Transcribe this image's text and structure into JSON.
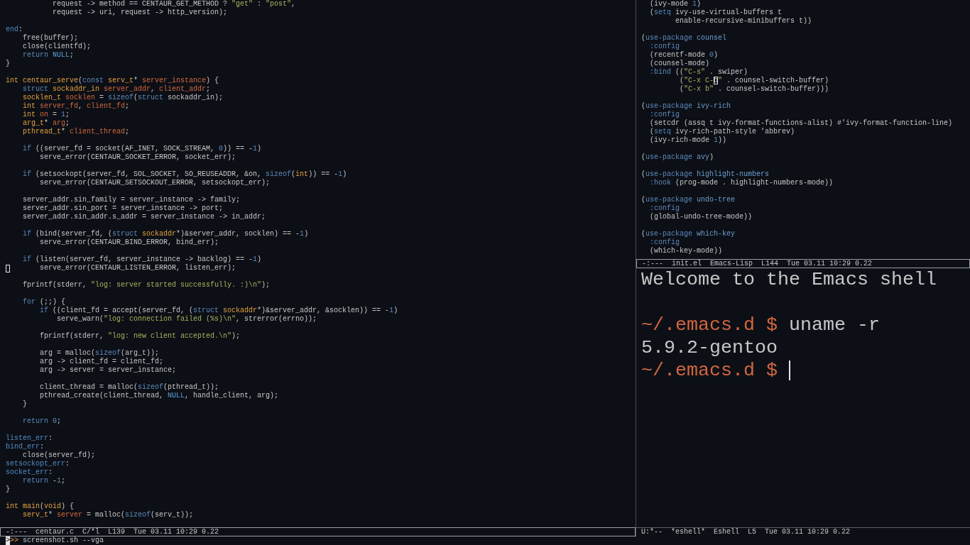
{
  "editor_window": {
    "blocks": [
      [
        [
          {
            "kind": "plain",
            "text": "           request -> method == CENTAUR_GET_METHOD ? "
          },
          {
            "kind": "string",
            "text": "\"get\""
          },
          {
            "kind": "plain",
            "text": " : "
          },
          {
            "kind": "string",
            "text": "\"post\""
          },
          {
            "kind": "plain",
            "text": ","
          }
        ],
        [
          {
            "kind": "plain",
            "text": "           request -> uri, request -> http_version);"
          }
        ]
      ],
      [
        [
          {
            "kind": "label",
            "text": "end"
          },
          {
            "kind": "plain",
            "text": ":"
          }
        ],
        [
          {
            "kind": "plain",
            "text": "    free(buffer);"
          }
        ],
        [
          {
            "kind": "plain",
            "text": "    close(clientfd);"
          }
        ],
        [
          {
            "kind": "keyword",
            "text": "    return"
          },
          {
            "kind": "constant",
            "text": " NULL"
          },
          {
            "kind": "plain",
            "text": ";"
          }
        ],
        [
          {
            "kind": "plain",
            "text": "}"
          }
        ]
      ],
      [
        [
          {
            "kind": "type",
            "text": "int"
          },
          {
            "kind": "function",
            "text": " centaur_serve"
          },
          {
            "kind": "plain",
            "text": "("
          },
          {
            "kind": "keyword",
            "text": "const"
          },
          {
            "kind": "type",
            "text": " serv_t"
          },
          {
            "kind": "plain",
            "text": "* "
          },
          {
            "kind": "variable",
            "text": "server_instance"
          },
          {
            "kind": "plain",
            "text": ") {"
          }
        ],
        [
          {
            "kind": "keyword",
            "text": "    struct"
          },
          {
            "kind": "type",
            "text": " sockaddr_in"
          },
          {
            "kind": "variable",
            "text": " server_addr"
          },
          {
            "kind": "plain",
            "text": ", "
          },
          {
            "kind": "variable",
            "text": "client_addr"
          },
          {
            "kind": "plain",
            "text": ";"
          }
        ],
        [
          {
            "kind": "type",
            "text": "    socklen_t"
          },
          {
            "kind": "variable",
            "text": " socklen"
          },
          {
            "kind": "plain",
            "text": " = "
          },
          {
            "kind": "keyword",
            "text": "sizeof"
          },
          {
            "kind": "plain",
            "text": "("
          },
          {
            "kind": "keyword",
            "text": "struct"
          },
          {
            "kind": "plain",
            "text": " sockaddr_in);"
          }
        ],
        [
          {
            "kind": "type",
            "text": "    int"
          },
          {
            "kind": "variable",
            "text": " server_fd"
          },
          {
            "kind": "plain",
            "text": ", "
          },
          {
            "kind": "variable",
            "text": "client_fd"
          },
          {
            "kind": "plain",
            "text": ";"
          }
        ],
        [
          {
            "kind": "type",
            "text": "    int"
          },
          {
            "kind": "variable",
            "text": " on"
          },
          {
            "kind": "plain",
            "text": " = "
          },
          {
            "kind": "number",
            "text": "1"
          },
          {
            "kind": "plain",
            "text": ";"
          }
        ],
        [
          {
            "kind": "type",
            "text": "    arg_t"
          },
          {
            "kind": "plain",
            "text": "* "
          },
          {
            "kind": "variable",
            "text": "arg"
          },
          {
            "kind": "plain",
            "text": ";"
          }
        ],
        [
          {
            "kind": "type",
            "text": "    pthread_t"
          },
          {
            "kind": "plain",
            "text": "* "
          },
          {
            "kind": "variable",
            "text": "client_thread"
          },
          {
            "kind": "plain",
            "text": ";"
          }
        ]
      ],
      [
        [
          {
            "kind": "keyword",
            "text": "    if"
          },
          {
            "kind": "plain",
            "text": " ((server_fd = socket(AF_INET, SOCK_STREAM, "
          },
          {
            "kind": "number",
            "text": "0"
          },
          {
            "kind": "plain",
            "text": ")) == -"
          },
          {
            "kind": "number",
            "text": "1"
          },
          {
            "kind": "plain",
            "text": ")"
          }
        ],
        [
          {
            "kind": "plain",
            "text": "        serve_error(CENTAUR_SOCKET_ERROR, socket_err);"
          }
        ]
      ],
      [
        [
          {
            "kind": "keyword",
            "text": "    if"
          },
          {
            "kind": "plain",
            "text": " (setsockopt(server_fd, SOL_SOCKET, SO_REUSEADDR, &on, "
          },
          {
            "kind": "keyword",
            "text": "sizeof"
          },
          {
            "kind": "plain",
            "text": "("
          },
          {
            "kind": "type",
            "text": "int"
          },
          {
            "kind": "plain",
            "text": ")) == -"
          },
          {
            "kind": "number",
            "text": "1"
          },
          {
            "kind": "plain",
            "text": ")"
          }
        ],
        [
          {
            "kind": "plain",
            "text": "        serve_error(CENTAUR_SETSOCKOUT_ERROR, setsockopt_err);"
          }
        ]
      ],
      [
        [
          {
            "kind": "plain",
            "text": "    server_addr.sin_family = server_instance -> family;"
          }
        ],
        [
          {
            "kind": "plain",
            "text": "    server_addr.sin_port = server_instance -> port;"
          }
        ],
        [
          {
            "kind": "plain",
            "text": "    server_addr.sin_addr.s_addr = server_instance -> in_addr;"
          }
        ]
      ],
      [
        [
          {
            "kind": "keyword",
            "text": "    if"
          },
          {
            "kind": "plain",
            "text": " (bind(server_fd, ("
          },
          {
            "kind": "keyword",
            "text": "struct"
          },
          {
            "kind": "type",
            "text": " sockaddr"
          },
          {
            "kind": "plain",
            "text": "*)&server_addr, socklen) == -"
          },
          {
            "kind": "number",
            "text": "1"
          },
          {
            "kind": "plain",
            "text": ")"
          }
        ],
        [
          {
            "kind": "plain",
            "text": "        serve_error(CENTAUR_BIND_ERROR, bind_err);"
          }
        ]
      ],
      [
        [
          {
            "kind": "keyword",
            "text": "    if"
          },
          {
            "kind": "plain",
            "text": " (listen(server_fd, server_instance -> backlog) == -"
          },
          {
            "kind": "number",
            "text": "1"
          },
          {
            "kind": "plain",
            "text": ")"
          }
        ],
        [
          {
            "kind": "box_cursor"
          },
          {
            "kind": "plain",
            "text": "       serve_error(CENTAUR_LISTEN_ERROR, listen_err);"
          }
        ]
      ],
      [
        [
          {
            "kind": "plain",
            "text": "    fprintf(stderr, "
          },
          {
            "kind": "string",
            "text": "\"log: server started successfully. :)\\n\""
          },
          {
            "kind": "plain",
            "text": ");"
          }
        ]
      ],
      [
        [
          {
            "kind": "keyword",
            "text": "    for"
          },
          {
            "kind": "plain",
            "text": " (;;) {"
          }
        ],
        [
          {
            "kind": "keyword",
            "text": "        if"
          },
          {
            "kind": "plain",
            "text": " ((client_fd = accept(server_fd, ("
          },
          {
            "kind": "keyword",
            "text": "struct"
          },
          {
            "kind": "type",
            "text": " sockaddr"
          },
          {
            "kind": "plain",
            "text": "*)&server_addr, &socklen)) == -"
          },
          {
            "kind": "number",
            "text": "1"
          },
          {
            "kind": "plain",
            "text": ")"
          }
        ],
        [
          {
            "kind": "plain",
            "text": "            serve_warn("
          },
          {
            "kind": "string",
            "text": "\"log: connection failed (%s)\\n\""
          },
          {
            "kind": "plain",
            "text": ", strerror(errno));"
          }
        ]
      ],
      [
        [
          {
            "kind": "plain",
            "text": "        fprintf(stderr, "
          },
          {
            "kind": "string",
            "text": "\"log: new client accepted.\\n\""
          },
          {
            "kind": "plain",
            "text": ");"
          }
        ]
      ],
      [
        [
          {
            "kind": "plain",
            "text": "        arg = malloc("
          },
          {
            "kind": "keyword",
            "text": "sizeof"
          },
          {
            "kind": "plain",
            "text": "(arg_t));"
          }
        ],
        [
          {
            "kind": "plain",
            "text": "        arg -> client_fd = client_fd;"
          }
        ],
        [
          {
            "kind": "plain",
            "text": "        arg -> server = server_instance;"
          }
        ]
      ],
      [
        [
          {
            "kind": "plain",
            "text": "        client_thread = malloc("
          },
          {
            "kind": "keyword",
            "text": "sizeof"
          },
          {
            "kind": "plain",
            "text": "(pthread_t));"
          }
        ],
        [
          {
            "kind": "plain",
            "text": "        pthread_create(client_thread, "
          },
          {
            "kind": "constant",
            "text": "NULL"
          },
          {
            "kind": "plain",
            "text": ", handle_client, arg);"
          }
        ],
        [
          {
            "kind": "plain",
            "text": "    }"
          }
        ]
      ],
      [
        [
          {
            "kind": "keyword",
            "text": "    return"
          },
          {
            "kind": "number",
            "text": " 0"
          },
          {
            "kind": "plain",
            "text": ";"
          }
        ]
      ],
      [
        [
          {
            "kind": "label",
            "text": "listen_err"
          },
          {
            "kind": "plain",
            "text": ":"
          }
        ],
        [
          {
            "kind": "label",
            "text": "bind_err"
          },
          {
            "kind": "plain",
            "text": ":"
          }
        ],
        [
          {
            "kind": "plain",
            "text": "    close(server_fd);"
          }
        ],
        [
          {
            "kind": "label",
            "text": "setsockopt_err"
          },
          {
            "kind": "plain",
            "text": ":"
          }
        ],
        [
          {
            "kind": "label",
            "text": "socket_err"
          },
          {
            "kind": "plain",
            "text": ":"
          }
        ],
        [
          {
            "kind": "keyword",
            "text": "    return"
          },
          {
            "kind": "plain",
            "text": " -"
          },
          {
            "kind": "number",
            "text": "1"
          },
          {
            "kind": "plain",
            "text": ";"
          }
        ],
        [
          {
            "kind": "plain",
            "text": "}"
          }
        ]
      ],
      [
        [
          {
            "kind": "type",
            "text": "int"
          },
          {
            "kind": "function",
            "text": " main"
          },
          {
            "kind": "plain",
            "text": "("
          },
          {
            "kind": "type",
            "text": "void"
          },
          {
            "kind": "plain",
            "text": ") {"
          }
        ],
        [
          {
            "kind": "type",
            "text": "    serv_t"
          },
          {
            "kind": "plain",
            "text": "* "
          },
          {
            "kind": "variable",
            "text": "server"
          },
          {
            "kind": "plain",
            "text": " = malloc("
          },
          {
            "kind": "keyword",
            "text": "sizeof"
          },
          {
            "kind": "plain",
            "text": "(serv_t));"
          }
        ]
      ]
    ],
    "mode_line": {
      "text": "-:---  centaur.c  C/*l  L139  Tue 03.11 10:29 0.22",
      "boxed": true
    }
  },
  "config_window": {
    "blocks": [
      [
        [
          {
            "kind": "plain",
            "text": "  (ivy-mode "
          },
          {
            "kind": "number",
            "text": "1"
          },
          {
            "kind": "plain",
            "text": ")"
          }
        ],
        [
          {
            "kind": "plain",
            "text": "  ("
          },
          {
            "kind": "keyword",
            "text": "setq"
          },
          {
            "kind": "plain",
            "text": " ivy-use-virtual-buffers t"
          }
        ],
        [
          {
            "kind": "plain",
            "text": "        enable-recursive-minibuffers t))"
          }
        ]
      ],
      [
        [
          {
            "kind": "plain",
            "text": "("
          },
          {
            "kind": "keyword",
            "text": "use-package"
          },
          {
            "kind": "package",
            "text": " counsel"
          }
        ],
        [
          {
            "kind": "keyword",
            "text": "  :config"
          }
        ],
        [
          {
            "kind": "plain",
            "text": "  (recentf-mode "
          },
          {
            "kind": "number",
            "text": "0"
          },
          {
            "kind": "plain",
            "text": ")"
          }
        ],
        [
          {
            "kind": "plain",
            "text": "  (counsel-mode)"
          }
        ],
        [
          {
            "kind": "keyword",
            "text": "  :bind"
          },
          {
            "kind": "plain",
            "text": " (("
          },
          {
            "kind": "string",
            "text": "\"C-s\""
          },
          {
            "kind": "plain",
            "text": " . swiper)"
          }
        ],
        [
          {
            "kind": "plain",
            "text": "         ("
          },
          {
            "kind": "string",
            "text": "\"C-x C-"
          },
          {
            "kind": "box_cursor",
            "text": "b"
          },
          {
            "kind": "string",
            "text": "\""
          },
          {
            "kind": "plain",
            "text": " . counsel-switch-buffer)"
          }
        ],
        [
          {
            "kind": "plain",
            "text": "         ("
          },
          {
            "kind": "string",
            "text": "\"C-x b\""
          },
          {
            "kind": "plain",
            "text": " . counsel-switch-buffer)))"
          }
        ]
      ],
      [
        [
          {
            "kind": "plain",
            "text": "("
          },
          {
            "kind": "keyword",
            "text": "use-package"
          },
          {
            "kind": "package",
            "text": " ivy-rich"
          }
        ],
        [
          {
            "kind": "keyword",
            "text": "  :config"
          }
        ],
        [
          {
            "kind": "plain",
            "text": "  (setcdr (assq t ivy-format-functions-alist) #'ivy-format-function-line)"
          }
        ],
        [
          {
            "kind": "plain",
            "text": "  ("
          },
          {
            "kind": "keyword",
            "text": "setq"
          },
          {
            "kind": "plain",
            "text": " ivy-rich-path-style 'abbrev)"
          }
        ],
        [
          {
            "kind": "plain",
            "text": "  (ivy-rich-mode "
          },
          {
            "kind": "number",
            "text": "1"
          },
          {
            "kind": "plain",
            "text": "))"
          }
        ]
      ],
      [
        [
          {
            "kind": "plain",
            "text": "("
          },
          {
            "kind": "keyword",
            "text": "use-package"
          },
          {
            "kind": "package",
            "text": " avy"
          },
          {
            "kind": "plain",
            "text": ")"
          }
        ]
      ],
      [
        [
          {
            "kind": "plain",
            "text": "("
          },
          {
            "kind": "keyword",
            "text": "use-package"
          },
          {
            "kind": "package",
            "text": " highlight-numbers"
          }
        ],
        [
          {
            "kind": "keyword",
            "text": "  :hook"
          },
          {
            "kind": "plain",
            "text": " (prog-mode . highlight-numbers-mode))"
          }
        ]
      ],
      [
        [
          {
            "kind": "plain",
            "text": "("
          },
          {
            "kind": "keyword",
            "text": "use-package"
          },
          {
            "kind": "package",
            "text": " undo-tree"
          }
        ],
        [
          {
            "kind": "keyword",
            "text": "  :config"
          }
        ],
        [
          {
            "kind": "plain",
            "text": "  (global-undo-tree-mode))"
          }
        ]
      ],
      [
        [
          {
            "kind": "plain",
            "text": "("
          },
          {
            "kind": "keyword",
            "text": "use-package"
          },
          {
            "kind": "package",
            "text": " which-key"
          }
        ],
        [
          {
            "kind": "keyword",
            "text": "  :config"
          }
        ],
        [
          {
            "kind": "plain",
            "text": "  (which-key-mode))"
          }
        ]
      ]
    ],
    "mode_line": {
      "text": "-:---  init.el  Emacs-Lisp  L144  Tue 03.11 10:29 0.22",
      "boxed": true
    }
  },
  "shell_window": {
    "blocks": [
      [
        [
          {
            "kind": "plain",
            "text": "Welcome to the Emacs shell"
          }
        ]
      ],
      [
        [
          {
            "kind": "prompt",
            "text": "~/.emacs.d $"
          },
          {
            "kind": "plain",
            "text": " uname -r"
          }
        ],
        [
          {
            "kind": "plain",
            "text": "5.9.2-gentoo"
          }
        ],
        [
          {
            "kind": "prompt",
            "text": "~/.emacs.d $"
          },
          {
            "kind": "bar_cursor"
          }
        ]
      ]
    ],
    "mode_line": {
      "text": "U:*--  *eshell*  Eshell  L5  Tue 03.11 10:29 0.22",
      "boxed": false
    }
  },
  "minibuffer": {
    "segments": [
      {
        "kind": "block_cursor",
        "text": ">"
      },
      {
        "kind": "minibuffer_prompt",
        "text": ">>"
      },
      {
        "kind": "plain",
        "text": " screenshot.sh --vga"
      }
    ]
  }
}
